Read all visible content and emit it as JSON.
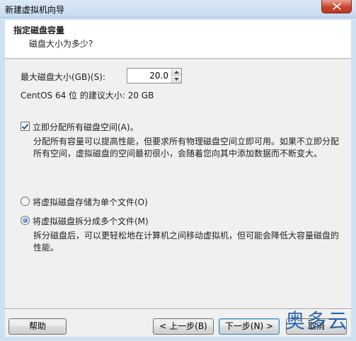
{
  "window": {
    "title": "新建虚拟机向导",
    "close_icon": "close-icon"
  },
  "header": {
    "title": "指定磁盘容量",
    "subtitle": "磁盘大小为多少?"
  },
  "disk_size": {
    "label": "最大磁盘大小(GB)(S):",
    "value": "20.0",
    "recommendation": "CentOS 64 位 的建议大小: 20 GB"
  },
  "allocate": {
    "checked": true,
    "label": "立即分配所有磁盘空间(A)。",
    "description_line1": "分配所有容量可以提高性能，但要求所有物理磁盘空间立即可用。如果不立即分配",
    "description_line2": "所有空间，虚拟磁盘的空间最初很小，会随着您向其中添加数据而不断变大。"
  },
  "storage": {
    "single_file_label": "将虚拟磁盘存储为单个文件(O)",
    "multi_file_label": "将虚拟磁盘拆分成多个文件(M)",
    "selected": "multi",
    "multi_description_line1": "拆分磁盘后，可以更轻松地在计算机之间移动虚拟机，但可能会降低大容量磁盘的",
    "multi_description_line2": "性能。"
  },
  "buttons": {
    "help": "帮助",
    "back": "< 上一步(B)",
    "next": "下一步(N) >",
    "cancel": "取消"
  },
  "watermark": "奥多云",
  "colors": {
    "title_bar": "#cfe0f1",
    "close_button": "#c9442c",
    "panel": "#f0f0f0",
    "watermark": "#1a5aa8"
  }
}
